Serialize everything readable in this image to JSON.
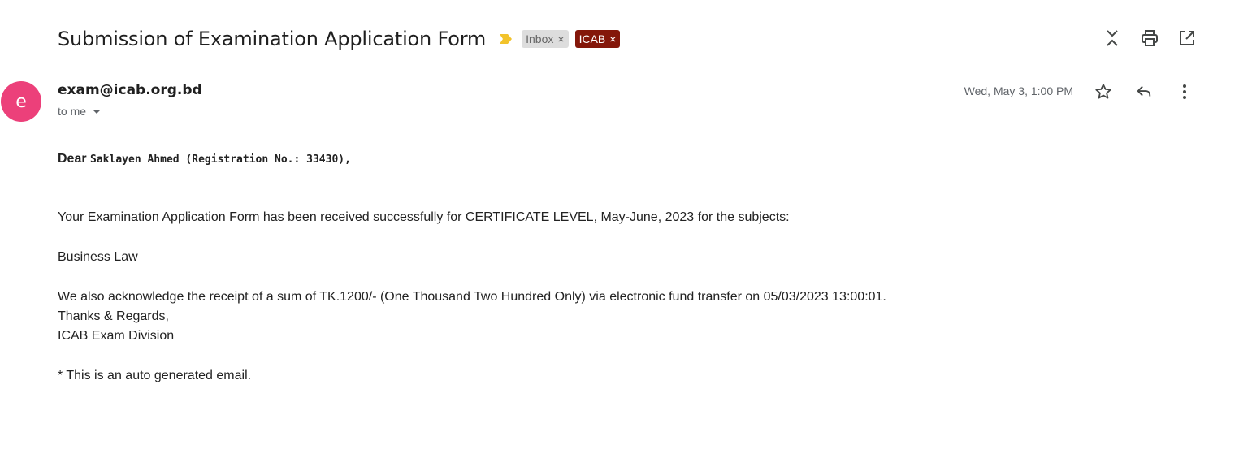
{
  "colors": {
    "importance_marker": "#f2c32b",
    "label_icab_bg": "#84170a",
    "avatar_bg": "#ec407a"
  },
  "header": {
    "subject": "Submission of Examination Application Form",
    "importance_icon": "importance-marker-icon",
    "labels": [
      {
        "name": "Inbox",
        "remove_glyph": "×"
      },
      {
        "name": "ICAB",
        "remove_glyph": "×"
      }
    ],
    "actions": [
      "expand-collapse-icon",
      "print-icon",
      "open-in-new-window-icon"
    ]
  },
  "message": {
    "avatar_letter": "e",
    "sender": "exam@icab.org.bd",
    "recipient": "to me",
    "date": "Wed, May 3, 1:00 PM",
    "actions": [
      "star-icon",
      "reply-icon",
      "more-vert-icon"
    ]
  },
  "body": {
    "greeting_word": "Dear",
    "greeting_name": "Saklayen Ahmed (Registration No.: 33430),",
    "para_received": "Your Examination Application Form has been received successfully for CERTIFICATE LEVEL, May-June, 2023 for the subjects:",
    "subject_list": "Business Law",
    "para_receipt": "We also acknowledge the receipt of a sum of TK.1200/- (One Thousand Two Hundred Only) via electronic fund transfer on 05/03/2023 13:00:01.",
    "closing": "Thanks & Regards,",
    "signature": "ICAB Exam Division",
    "footnote": "* This is an auto generated email."
  }
}
